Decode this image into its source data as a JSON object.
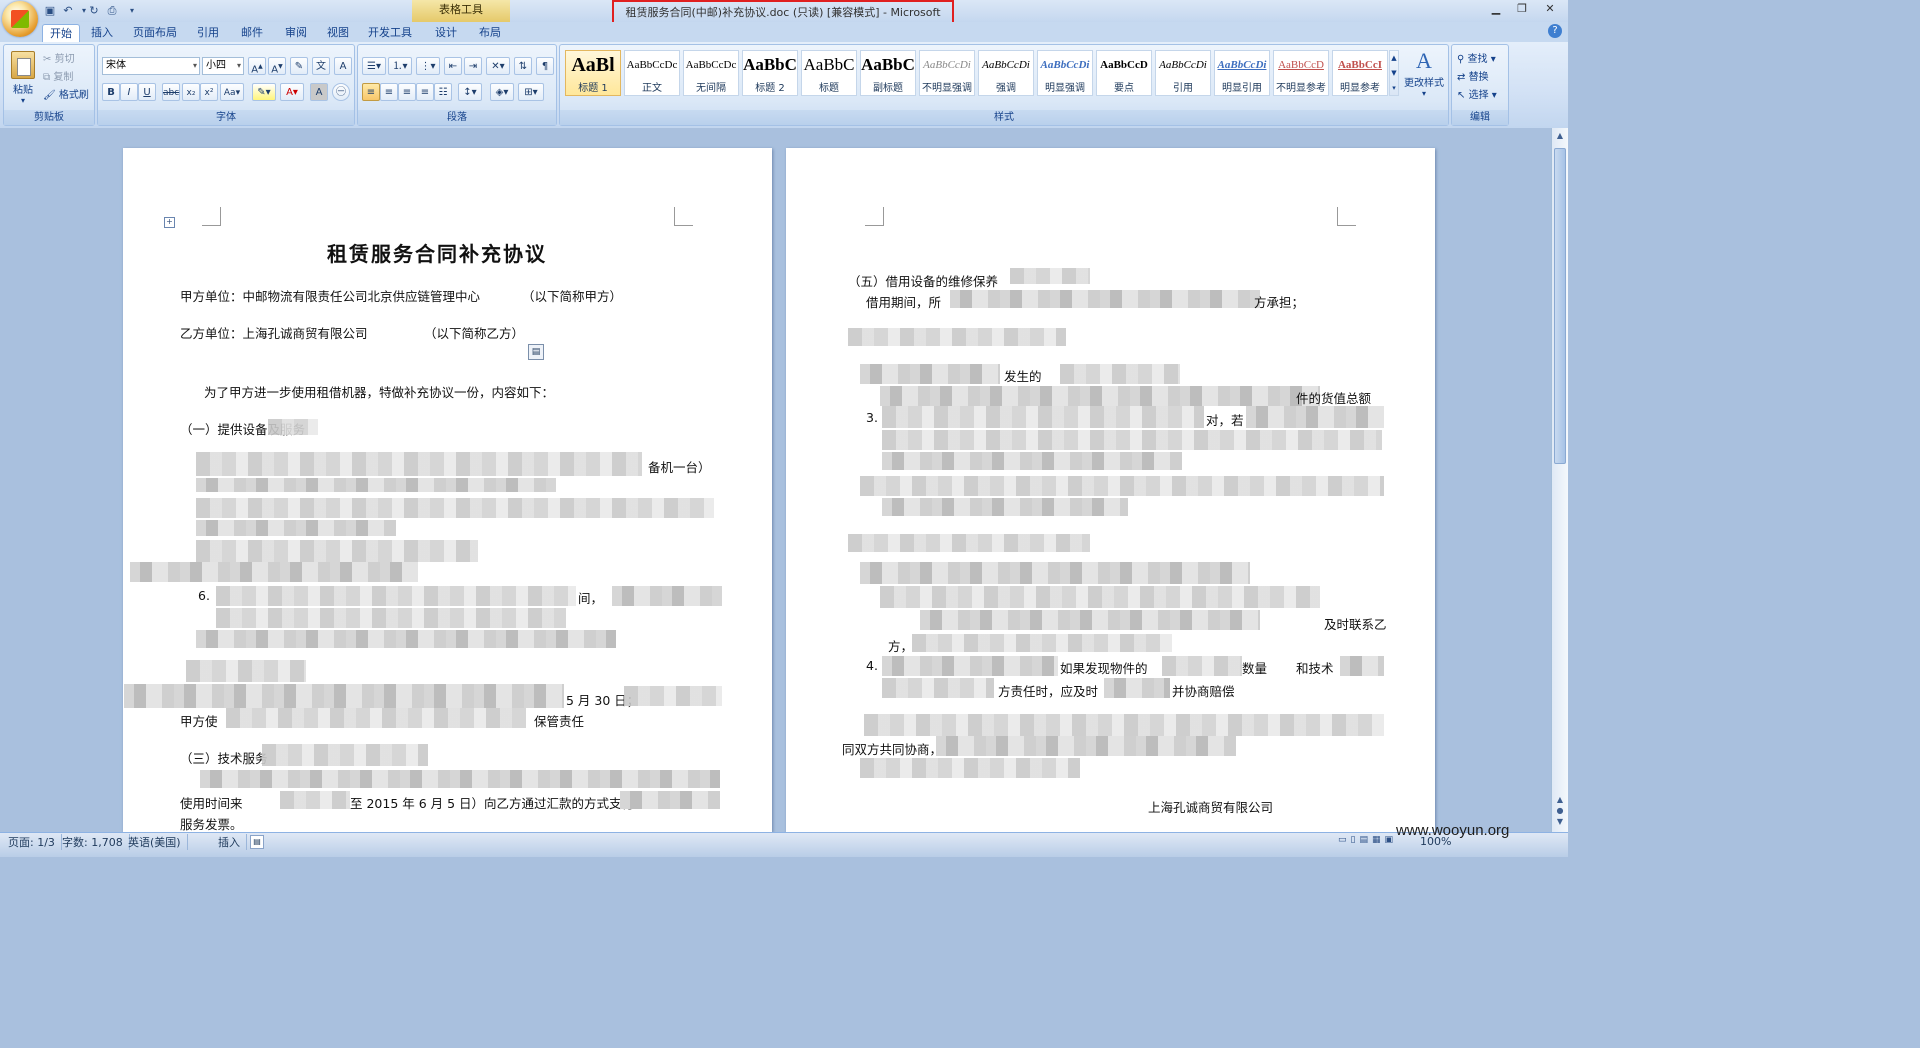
{
  "window": {
    "title": "租赁服务合同(中邮)补充协议.doc (只读) [兼容模式] - Microsoft Word",
    "context_tab_group": "表格工具"
  },
  "quick_access": [
    "save-icon",
    "undo-icon",
    "redo-icon",
    "print-preview-icon"
  ],
  "tabs": [
    "开始",
    "插入",
    "页面布局",
    "引用",
    "邮件",
    "审阅",
    "视图",
    "开发工具",
    "设计",
    "布局"
  ],
  "ribbon": {
    "clipboard": {
      "paste": "粘贴",
      "cut": "剪切",
      "copy": "复制",
      "format_painter": "格式刷",
      "label": "剪贴板"
    },
    "font": {
      "name": "宋体",
      "size": "小四",
      "label": "字体"
    },
    "paragraph": {
      "label": "段落"
    },
    "styles": {
      "label": "样式",
      "items": [
        {
          "preview": "AaBl",
          "name": "标题 1"
        },
        {
          "preview": "AaBbCcDc",
          "name": "正文"
        },
        {
          "preview": "AaBbCcDc",
          "name": "无间隔"
        },
        {
          "preview": "AaBbC",
          "name": "标题 2"
        },
        {
          "preview": "AaBbC",
          "name": "标题"
        },
        {
          "preview": "AaBbC",
          "name": "副标题"
        },
        {
          "preview": "AaBbCcDi",
          "name": "不明显强调"
        },
        {
          "preview": "AaBbCcDi",
          "name": "强调"
        },
        {
          "preview": "AaBbCcDi",
          "name": "明显强调"
        },
        {
          "preview": "AaBbCcD",
          "name": "要点"
        },
        {
          "preview": "AaBbCcDi",
          "name": "引用"
        },
        {
          "preview": "AaBbCcDi",
          "name": "明显引用"
        },
        {
          "preview": "AaBbCcD",
          "name": "不明显参考"
        },
        {
          "preview": "AaBbCcI",
          "name": "明显参考"
        }
      ],
      "change_styles": "更改样式"
    },
    "editing": {
      "find": "查找",
      "replace": "替换",
      "select": "选择",
      "label": "编辑"
    }
  },
  "document": {
    "page1": {
      "title": "租赁服务合同补充协议",
      "party_a": "甲方单位：中邮物流有限责任公司北京供应链管理中心",
      "party_a_note": "（以下简称甲方）",
      "party_b": "乙方单位：上海孔诚商贸有限公司",
      "party_b_note": "（以下简称乙方）",
      "intro": "为了甲方进一步使用租借机器，特做补充协议一份，内容如下：",
      "section1": "（一）提供设备及服务",
      "frag1": "备机一台）",
      "frag2": "6.",
      "frag3": "间，",
      "frag4": "5 月 30 日；",
      "frag5": "甲方使",
      "frag6": "保管责任",
      "section3": "（三）技术服务",
      "frag7": "使用时间来",
      "frag8": "至 2015 年 6 月 5 日）向乙方通过汇款的方式支付",
      "frag9": "服务发票。"
    },
    "page2": {
      "section5": "（五）借用设备的维修保养",
      "line1": "借用期间，所",
      "line1_end": "方承担；",
      "frag_a": "发生的",
      "frag_b": "件的货值总额",
      "frag_c": "3.",
      "frag_d": "对，若",
      "frag_e": "及时联系乙",
      "frag_f": "方，",
      "frag_g": "4.",
      "frag_h": "如果发现物件的",
      "frag_i": "数量",
      "frag_j": "和技术",
      "frag_k": "方责任时，应及时",
      "frag_l": "并协商赔偿",
      "frag_m": "同双方共同协商，",
      "signature": "上海孔诚商贸有限公司"
    }
  },
  "statusbar": {
    "page": "页面: 1/3",
    "words": "字数: 1,708",
    "language": "英语(美国)",
    "mode": "插入",
    "zoom": "100%"
  },
  "watermark": "www.wooyun.org"
}
